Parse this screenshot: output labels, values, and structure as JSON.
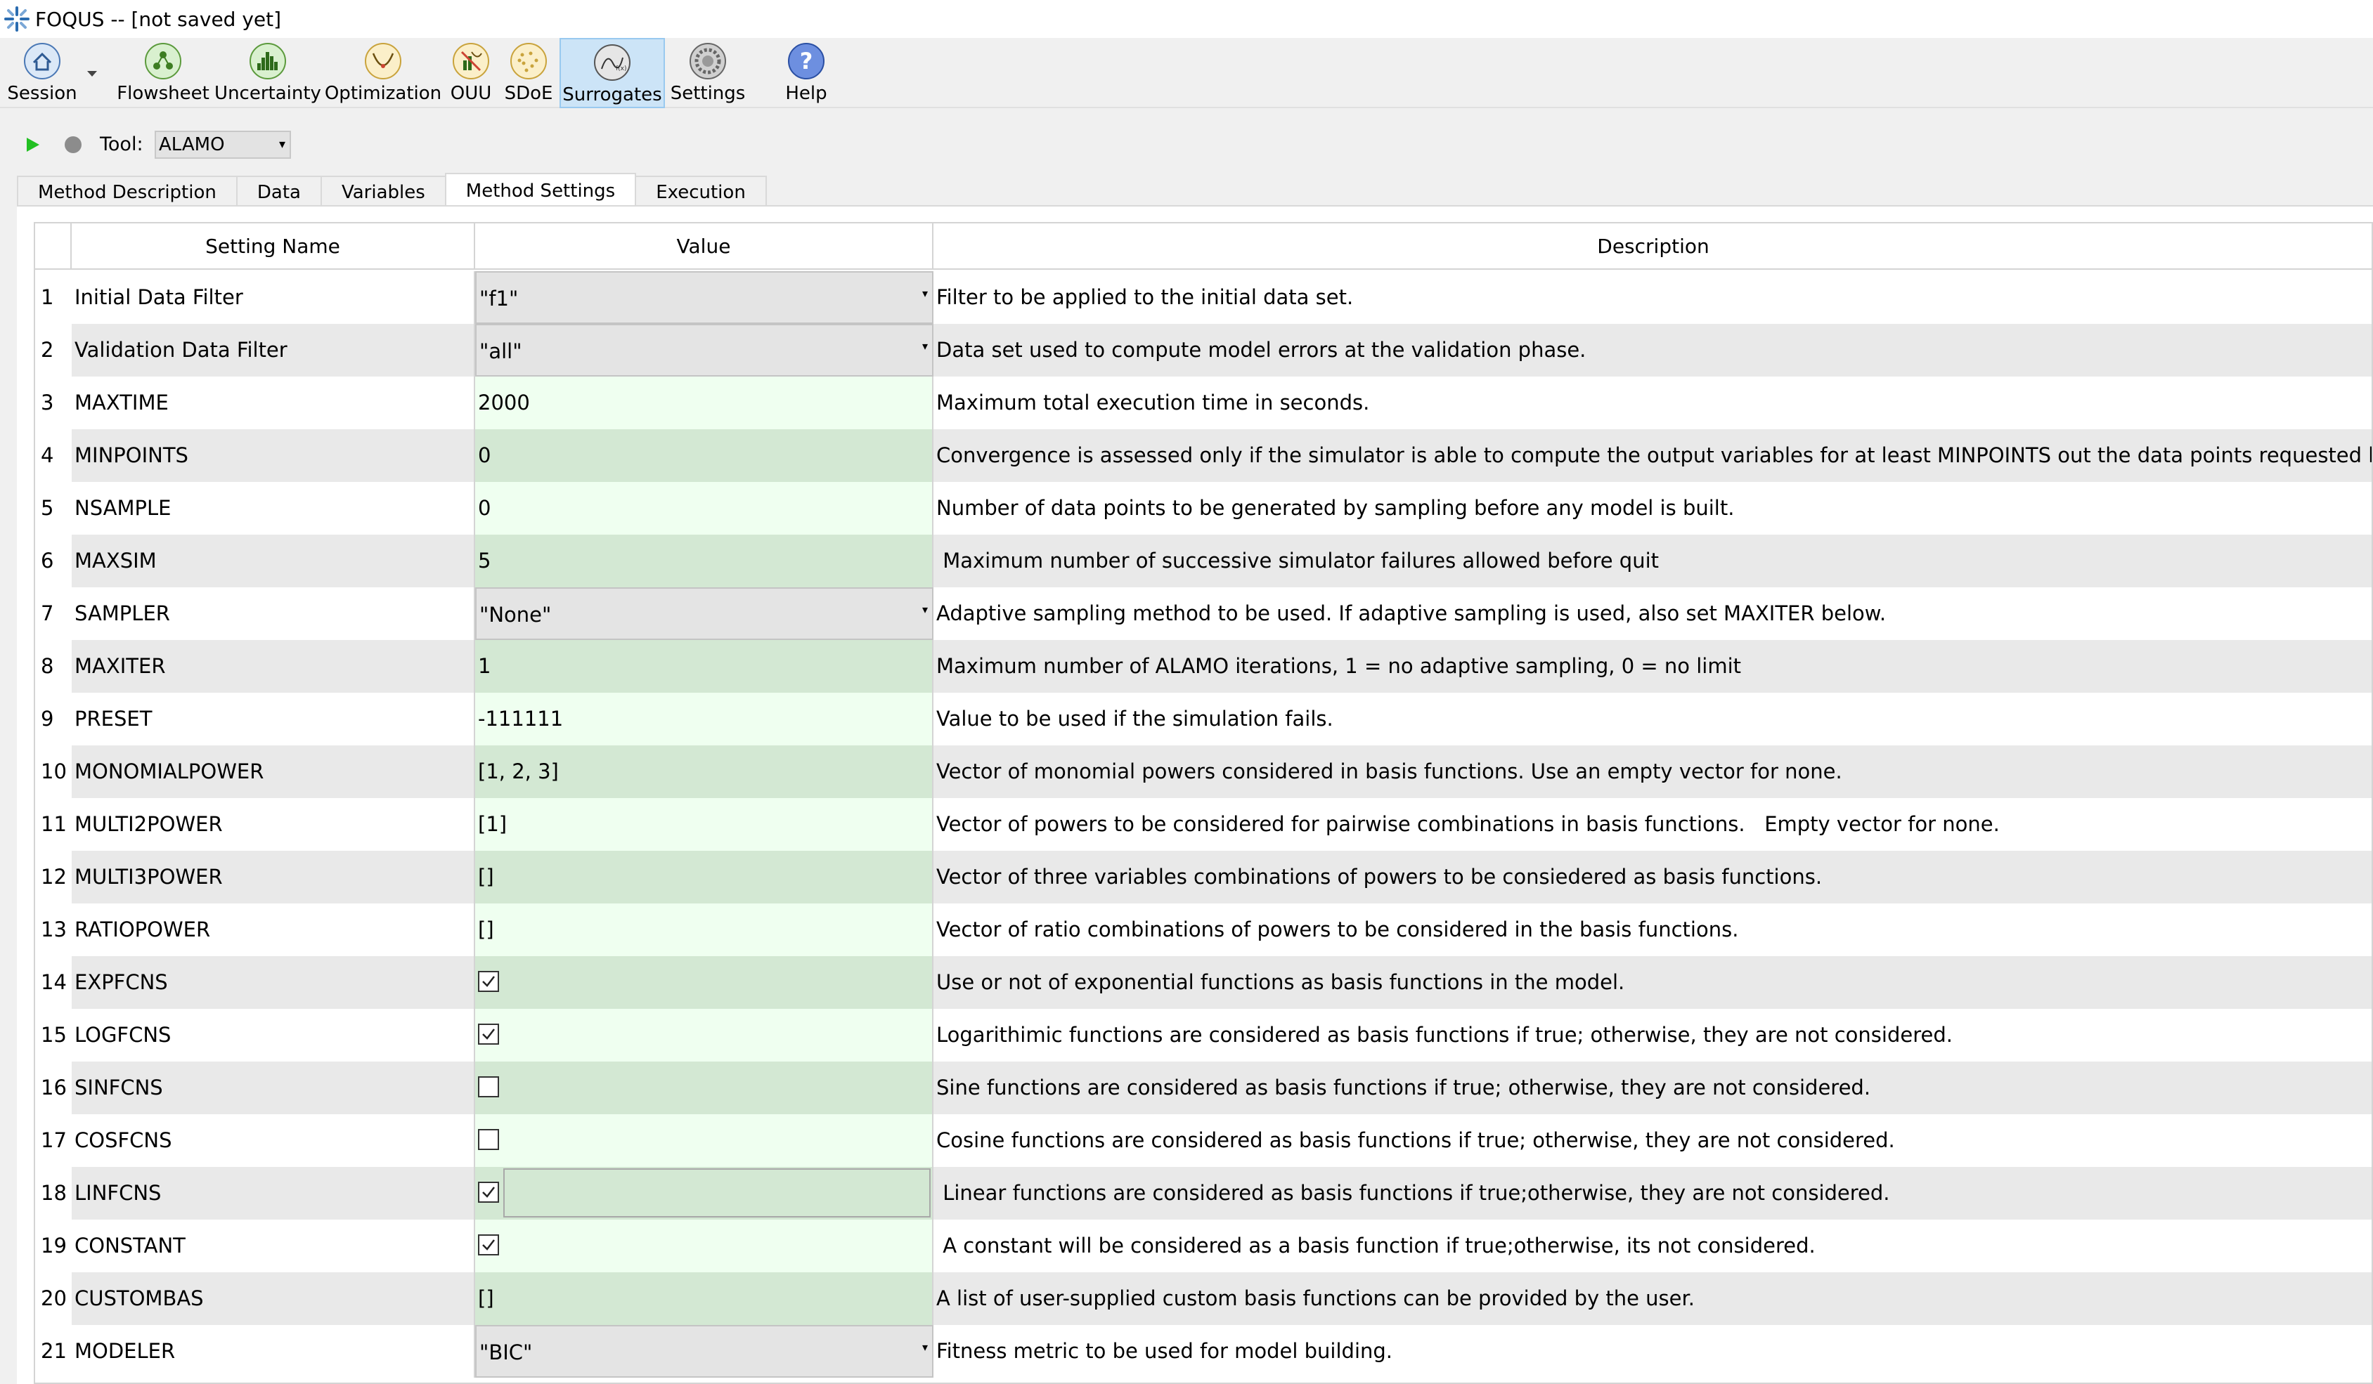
{
  "window": {
    "title": "FOQUS -- [not saved yet]"
  },
  "toolbar": {
    "items": [
      {
        "label": "Session",
        "icon": "house-icon"
      },
      {
        "label": "Flowsheet",
        "icon": "flowsheet-icon"
      },
      {
        "label": "Uncertainty",
        "icon": "histogram-icon"
      },
      {
        "label": "Optimization",
        "icon": "optimization-curve-icon"
      },
      {
        "label": "OUU",
        "icon": "ouu-icon"
      },
      {
        "label": "SDoE",
        "icon": "sdoe-icon"
      },
      {
        "label": "Surrogates",
        "icon": "surrogates-icon"
      },
      {
        "label": "Settings",
        "icon": "gear-icon"
      },
      {
        "label": "Help",
        "icon": "help-icon"
      }
    ],
    "active": "Surrogates"
  },
  "run": {
    "tool_label": "Tool:",
    "tool_value": "ALAMO"
  },
  "tabs": [
    {
      "label": "Method Description"
    },
    {
      "label": "Data"
    },
    {
      "label": "Variables"
    },
    {
      "label": "Method Settings"
    },
    {
      "label": "Execution"
    }
  ],
  "active_tab": "Method Settings",
  "table": {
    "headers": {
      "name": "Setting Name",
      "value": "Value",
      "desc": "Description"
    },
    "rows": [
      {
        "num": "1",
        "name": "Initial Data Filter",
        "value": "\"f1\"",
        "kind": "combo",
        "desc": "Filter to be applied to the initial data set."
      },
      {
        "num": "2",
        "name": "Validation Data Filter",
        "value": "\"all\"",
        "kind": "combo",
        "desc": "Data set used to compute model errors at the validation phase."
      },
      {
        "num": "3",
        "name": "MAXTIME",
        "value": "2000",
        "kind": "text",
        "desc": "Maximum total execution time in seconds."
      },
      {
        "num": "4",
        "name": "MINPOINTS",
        "value": "0",
        "kind": "text",
        "desc": "Convergence is assessed only if the simulator is able to compute the output variables for at least MINPOINTS out the data points requested by ALAMO."
      },
      {
        "num": "5",
        "name": "NSAMPLE",
        "value": "0",
        "kind": "text",
        "desc": "Number of data points to be generated by sampling before any model is built."
      },
      {
        "num": "6",
        "name": "MAXSIM",
        "value": "5",
        "kind": "text",
        "desc": " Maximum number of successive simulator failures allowed before quit"
      },
      {
        "num": "7",
        "name": "SAMPLER",
        "value": "\"None\"",
        "kind": "combo",
        "desc": "Adaptive sampling method to be used. If adaptive sampling is used, also set MAXITER below."
      },
      {
        "num": "8",
        "name": "MAXITER",
        "value": "1",
        "kind": "text",
        "desc": "Maximum number of ALAMO iterations, 1 = no adaptive sampling, 0 = no limit"
      },
      {
        "num": "9",
        "name": "PRESET",
        "value": "-111111",
        "kind": "text",
        "desc": "Value to be used if the simulation fails."
      },
      {
        "num": "10",
        "name": "MONOMIALPOWER",
        "value": "[1, 2, 3]",
        "kind": "text",
        "desc": "Vector of monomial powers considered in basis functions. Use an empty vector for none."
      },
      {
        "num": "11",
        "name": "MULTI2POWER",
        "value": "[1]",
        "kind": "text",
        "desc": "Vector of powers to be considered for pairwise combinations in basis functions.   Empty vector for none."
      },
      {
        "num": "12",
        "name": "MULTI3POWER",
        "value": "[]",
        "kind": "text",
        "desc": "Vector of three variables combinations of powers to be consiedered as basis functions."
      },
      {
        "num": "13",
        "name": "RATIOPOWER",
        "value": "[]",
        "kind": "text",
        "desc": "Vector of ratio combinations of powers to be considered in the basis functions."
      },
      {
        "num": "14",
        "name": "EXPFCNS",
        "value": "",
        "kind": "check",
        "checked": true,
        "desc": "Use or not of exponential functions as basis functions in the model."
      },
      {
        "num": "15",
        "name": "LOGFCNS",
        "value": "",
        "kind": "check",
        "checked": true,
        "desc": "Logarithimic functions are considered as basis functions if true; otherwise, they are not considered."
      },
      {
        "num": "16",
        "name": "SINFCNS",
        "value": "",
        "kind": "check",
        "checked": false,
        "desc": "Sine functions are considered as basis functions if true; otherwise, they are not considered."
      },
      {
        "num": "17",
        "name": "COSFCNS",
        "value": "",
        "kind": "check",
        "checked": false,
        "desc": "Cosine functions are considered as basis functions if true; otherwise, they are not considered."
      },
      {
        "num": "18",
        "name": "LINFCNS",
        "value": "",
        "kind": "check-edit",
        "checked": true,
        "desc": " Linear functions are considered as basis functions if true;otherwise, they are not considered."
      },
      {
        "num": "19",
        "name": "CONSTANT",
        "value": "",
        "kind": "check",
        "checked": true,
        "desc": " A constant will be considered as a basis function if true;otherwise, its not considered."
      },
      {
        "num": "20",
        "name": "CUSTOMBAS",
        "value": "[]",
        "kind": "text",
        "desc": "A list of user-supplied custom basis functions can be provided by the user."
      },
      {
        "num": "21",
        "name": "MODELER",
        "value": "\"BIC\"",
        "kind": "combo",
        "desc": "Fitness metric to be used for model building."
      }
    ]
  }
}
